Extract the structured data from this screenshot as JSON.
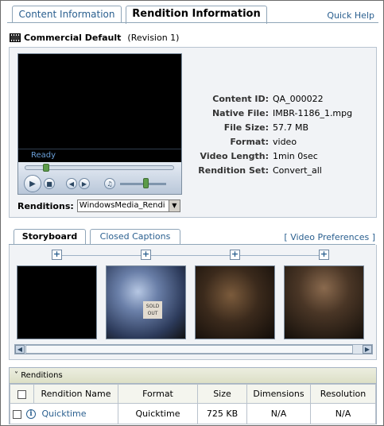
{
  "tabs": {
    "content_info": "Content Information",
    "rendition_info": "Rendition Information",
    "quick_help": "Quick Help"
  },
  "header": {
    "title": "Commercial Default",
    "revision": "(Revision 1)"
  },
  "player": {
    "status": "Ready",
    "seek_progress": 0.12,
    "volume": 0.55
  },
  "metadata": [
    {
      "label": "Content ID:",
      "value": "QA_000022"
    },
    {
      "label": "Native File:",
      "value": "IMBR-1186_1.mpg"
    },
    {
      "label": "File Size:",
      "value": "57.7 MB"
    },
    {
      "label": "Format:",
      "value": "video"
    },
    {
      "label": "Video Length:",
      "value": "1min 0sec"
    },
    {
      "label": "Rendition Set:",
      "value": "Convert_all"
    }
  ],
  "renditions_select": {
    "label": "Renditions:",
    "value": "WindowsMedia_Rendi"
  },
  "storyboard_tabs": {
    "storyboard": "Storyboard",
    "closed_captions": "Closed Captions",
    "video_prefs": "[ Video Preferences ]"
  },
  "storyboard": {
    "frame2_sign": "SOLD OUT"
  },
  "renditions_table": {
    "section_title": "Renditions",
    "columns": [
      "Rendition Name",
      "Format",
      "Size",
      "Dimensions",
      "Resolution"
    ],
    "rows": [
      {
        "name": "Quicktime",
        "format": "Quicktime",
        "size": "725 KB",
        "dimensions": "N/A",
        "resolution": "N/A"
      }
    ]
  },
  "colors": {
    "link": "#2a5f8f",
    "panel_bg": "#f1f3f6",
    "border": "#8fa5b8"
  }
}
